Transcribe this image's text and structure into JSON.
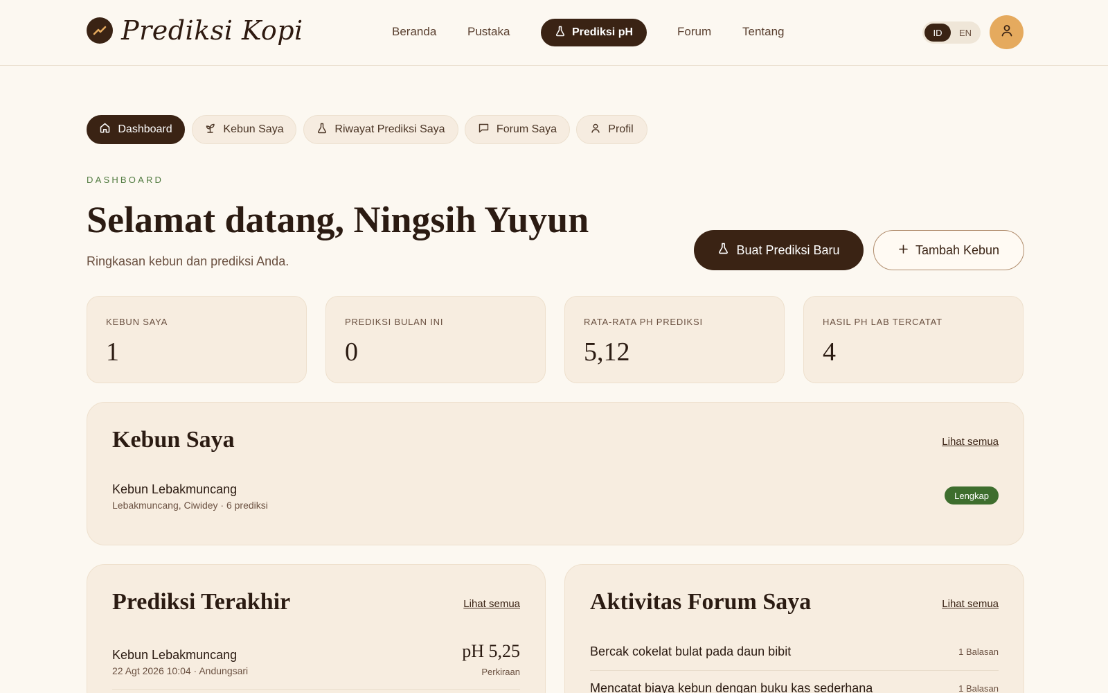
{
  "app": {
    "brand": "Prediksi Kopi"
  },
  "nav": {
    "items": [
      {
        "label": "Beranda"
      },
      {
        "label": "Pustaka"
      },
      {
        "label": "Prediksi pH"
      },
      {
        "label": "Forum"
      },
      {
        "label": "Tentang"
      }
    ],
    "active": "Prediksi pH"
  },
  "lang": {
    "id": "ID",
    "en": "EN",
    "active": "ID"
  },
  "tabs": [
    {
      "label": "Dashboard",
      "icon": "home-icon"
    },
    {
      "label": "Kebun Saya",
      "icon": "sprout-icon"
    },
    {
      "label": "Riwayat Prediksi Saya",
      "icon": "flask-icon"
    },
    {
      "label": "Forum Saya",
      "icon": "chat-icon"
    },
    {
      "label": "Profil",
      "icon": "user-icon"
    }
  ],
  "header": {
    "eyebrow": "DASHBOARD",
    "title": "Selamat datang, Ningsih Yuyun",
    "subtitle": "Ringkasan kebun dan prediksi Anda.",
    "primary_button": "Buat Prediksi Baru",
    "secondary_button": "Tambah Kebun"
  },
  "stats": [
    {
      "label": "KEBUN SAYA",
      "value": "1"
    },
    {
      "label": "PREDIKSI BULAN INI",
      "value": "0"
    },
    {
      "label": "RATA-RATA PH PREDIKSI",
      "value": "5,12"
    },
    {
      "label": "HASIL PH LAB TERCATAT",
      "value": "4"
    }
  ],
  "gardens": {
    "title": "Kebun Saya",
    "link": "Lihat semua",
    "items": [
      {
        "name": "Kebun Lebakmuncang",
        "meta": "Lebakmuncang, Ciwidey · 6 prediksi",
        "badge": "Lengkap"
      }
    ]
  },
  "predictions": {
    "title": "Prediksi Terakhir",
    "link": "Lihat semua",
    "items": [
      {
        "name": "Kebun Lebakmuncang",
        "meta": "22 Agt 2026 10:04 · Andungsari",
        "ph": "pH 5,25",
        "note": "Perkiraan"
      }
    ]
  },
  "forum": {
    "title": "Aktivitas Forum Saya",
    "link": "Lihat semua",
    "items": [
      {
        "title": "Bercak cokelat bulat pada daun bibit",
        "replies": "1 Balasan"
      },
      {
        "title": "Mencatat biaya kebun dengan buku kas sederhana",
        "replies": "1 Balasan"
      }
    ]
  },
  "colors": {
    "primary": "#3a2314",
    "accent": "#e5aa5e",
    "success": "#3e6e2e",
    "background": "#fcf8f1"
  }
}
